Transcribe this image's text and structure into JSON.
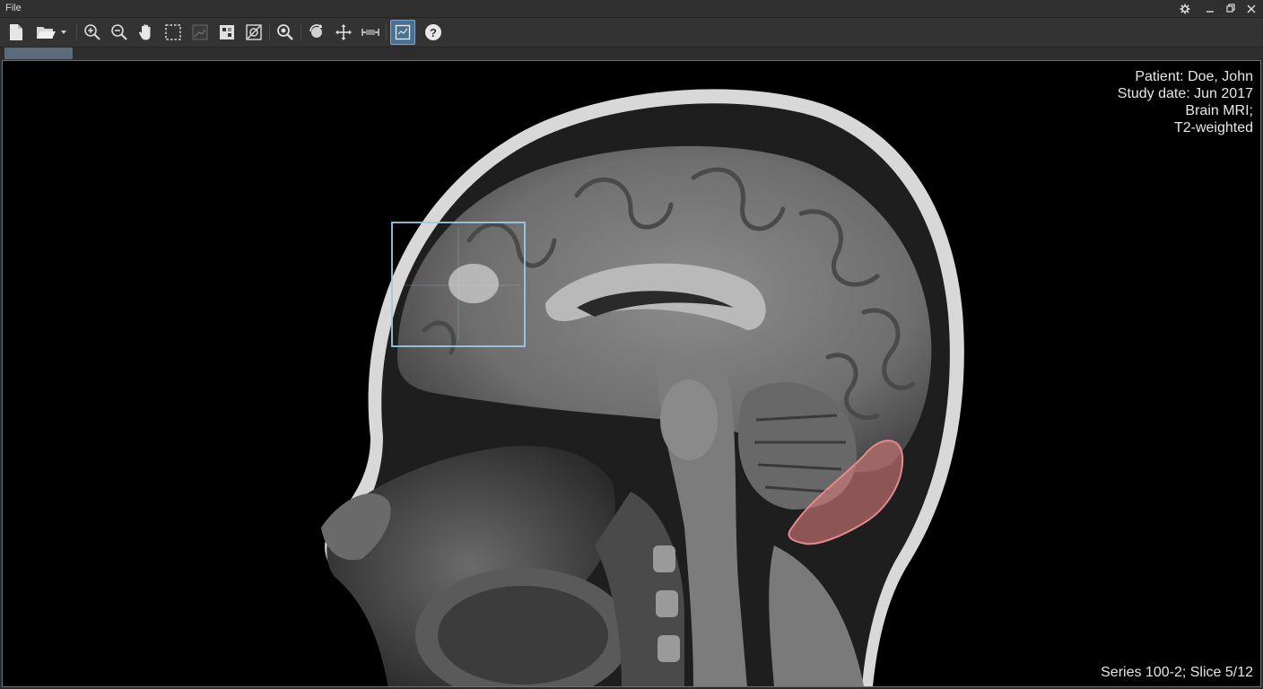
{
  "menu": {
    "file_label": "File"
  },
  "toolbar": {
    "tools": [
      {
        "name": "new-file-icon",
        "active": false
      },
      {
        "name": "open-folder-icon",
        "active": false
      },
      {
        "name": "zoom-in-icon",
        "active": false
      },
      {
        "name": "zoom-out-icon",
        "active": false
      },
      {
        "name": "pan-hand-icon",
        "active": false
      },
      {
        "name": "select-rectangle-icon",
        "active": false
      },
      {
        "name": "window-level-icon",
        "active": false
      },
      {
        "name": "invert-icon",
        "active": false
      },
      {
        "name": "contrast-icon",
        "active": false
      },
      {
        "name": "magnify-icon",
        "active": false
      },
      {
        "name": "rotate-icon",
        "active": false
      },
      {
        "name": "move-icon",
        "active": false
      },
      {
        "name": "measure-icon",
        "active": false
      },
      {
        "name": "roi-overlay-icon",
        "active": true
      },
      {
        "name": "help-icon",
        "active": false
      }
    ]
  },
  "overlay": {
    "patient": "Patient: Doe, John",
    "study_date": "Study date: Jun 2017",
    "study_type": "Brain MRI;",
    "sequence": "T2-weighted",
    "series": "Series 100-2; Slice 5/12"
  },
  "colors": {
    "roi_box": "#9ccbe6",
    "lesion_fill": "#d9797a",
    "active_tool": "#4a6f93"
  }
}
